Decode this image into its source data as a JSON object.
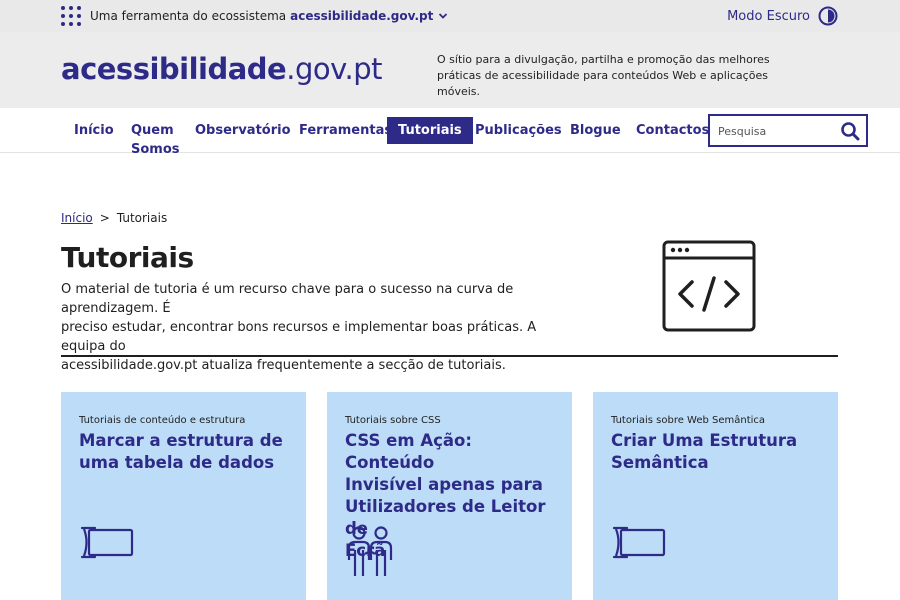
{
  "topbar": {
    "ecosystem_text": "Uma ferramenta do ecossistema",
    "ecosystem_link": "acessibilidade.gov.pt",
    "dark_mode_label": "Modo Escuro"
  },
  "header": {
    "logo_bold": "acessibilidade",
    "logo_rest": ".gov.pt",
    "tagline": "O sítio para a divulgação, partilha e promoção das melhores práticas de acessibilidade para conteúdos Web e aplicações móveis."
  },
  "nav": {
    "items": [
      {
        "label": "Início"
      },
      {
        "label": "Quem"
      },
      {
        "label": "Somos"
      },
      {
        "label": "Observatório"
      },
      {
        "label": "Ferramentas"
      },
      {
        "label": "Tutoriais"
      },
      {
        "label": "Publicações"
      },
      {
        "label": "Blogue"
      },
      {
        "label": "Contactos"
      }
    ],
    "active": "Tutoriais",
    "search_placeholder": "Pesquisa"
  },
  "breadcrumb": {
    "home": "Início",
    "separator": ">",
    "current": "Tutoriais"
  },
  "main": {
    "title": "Tutoriais",
    "intro_lines": [
      "O material de tutoria é um recurso chave para o sucesso na curva de aprendizagem. É",
      "preciso estudar, encontrar bons recursos e implementar boas práticas. A equipa do",
      "acessibilidade.gov.pt atualiza frequentemente a secção de tutoriais."
    ]
  },
  "cards": [
    {
      "category": "Tutoriais de conteúdo e estrutura",
      "title_lines": [
        "Marcar a estrutura de",
        "uma tabela de dados"
      ],
      "icon": "table-icon"
    },
    {
      "category": "Tutoriais sobre CSS",
      "title_lines": [
        "CSS em Ação: Conteúdo",
        "Invisível apenas para",
        "Utilizadores de Leitor de",
        "Ecrã"
      ],
      "icon": "people-icon"
    },
    {
      "category": "Tutoriais sobre Web Semântica",
      "title_lines": [
        "Criar Uma Estrutura",
        "Semântica"
      ],
      "icon": "table-icon"
    }
  ],
  "colors": {
    "brand": "#2e2a88",
    "card_bg": "#bcdcf7",
    "header_bg": "#ececec"
  }
}
